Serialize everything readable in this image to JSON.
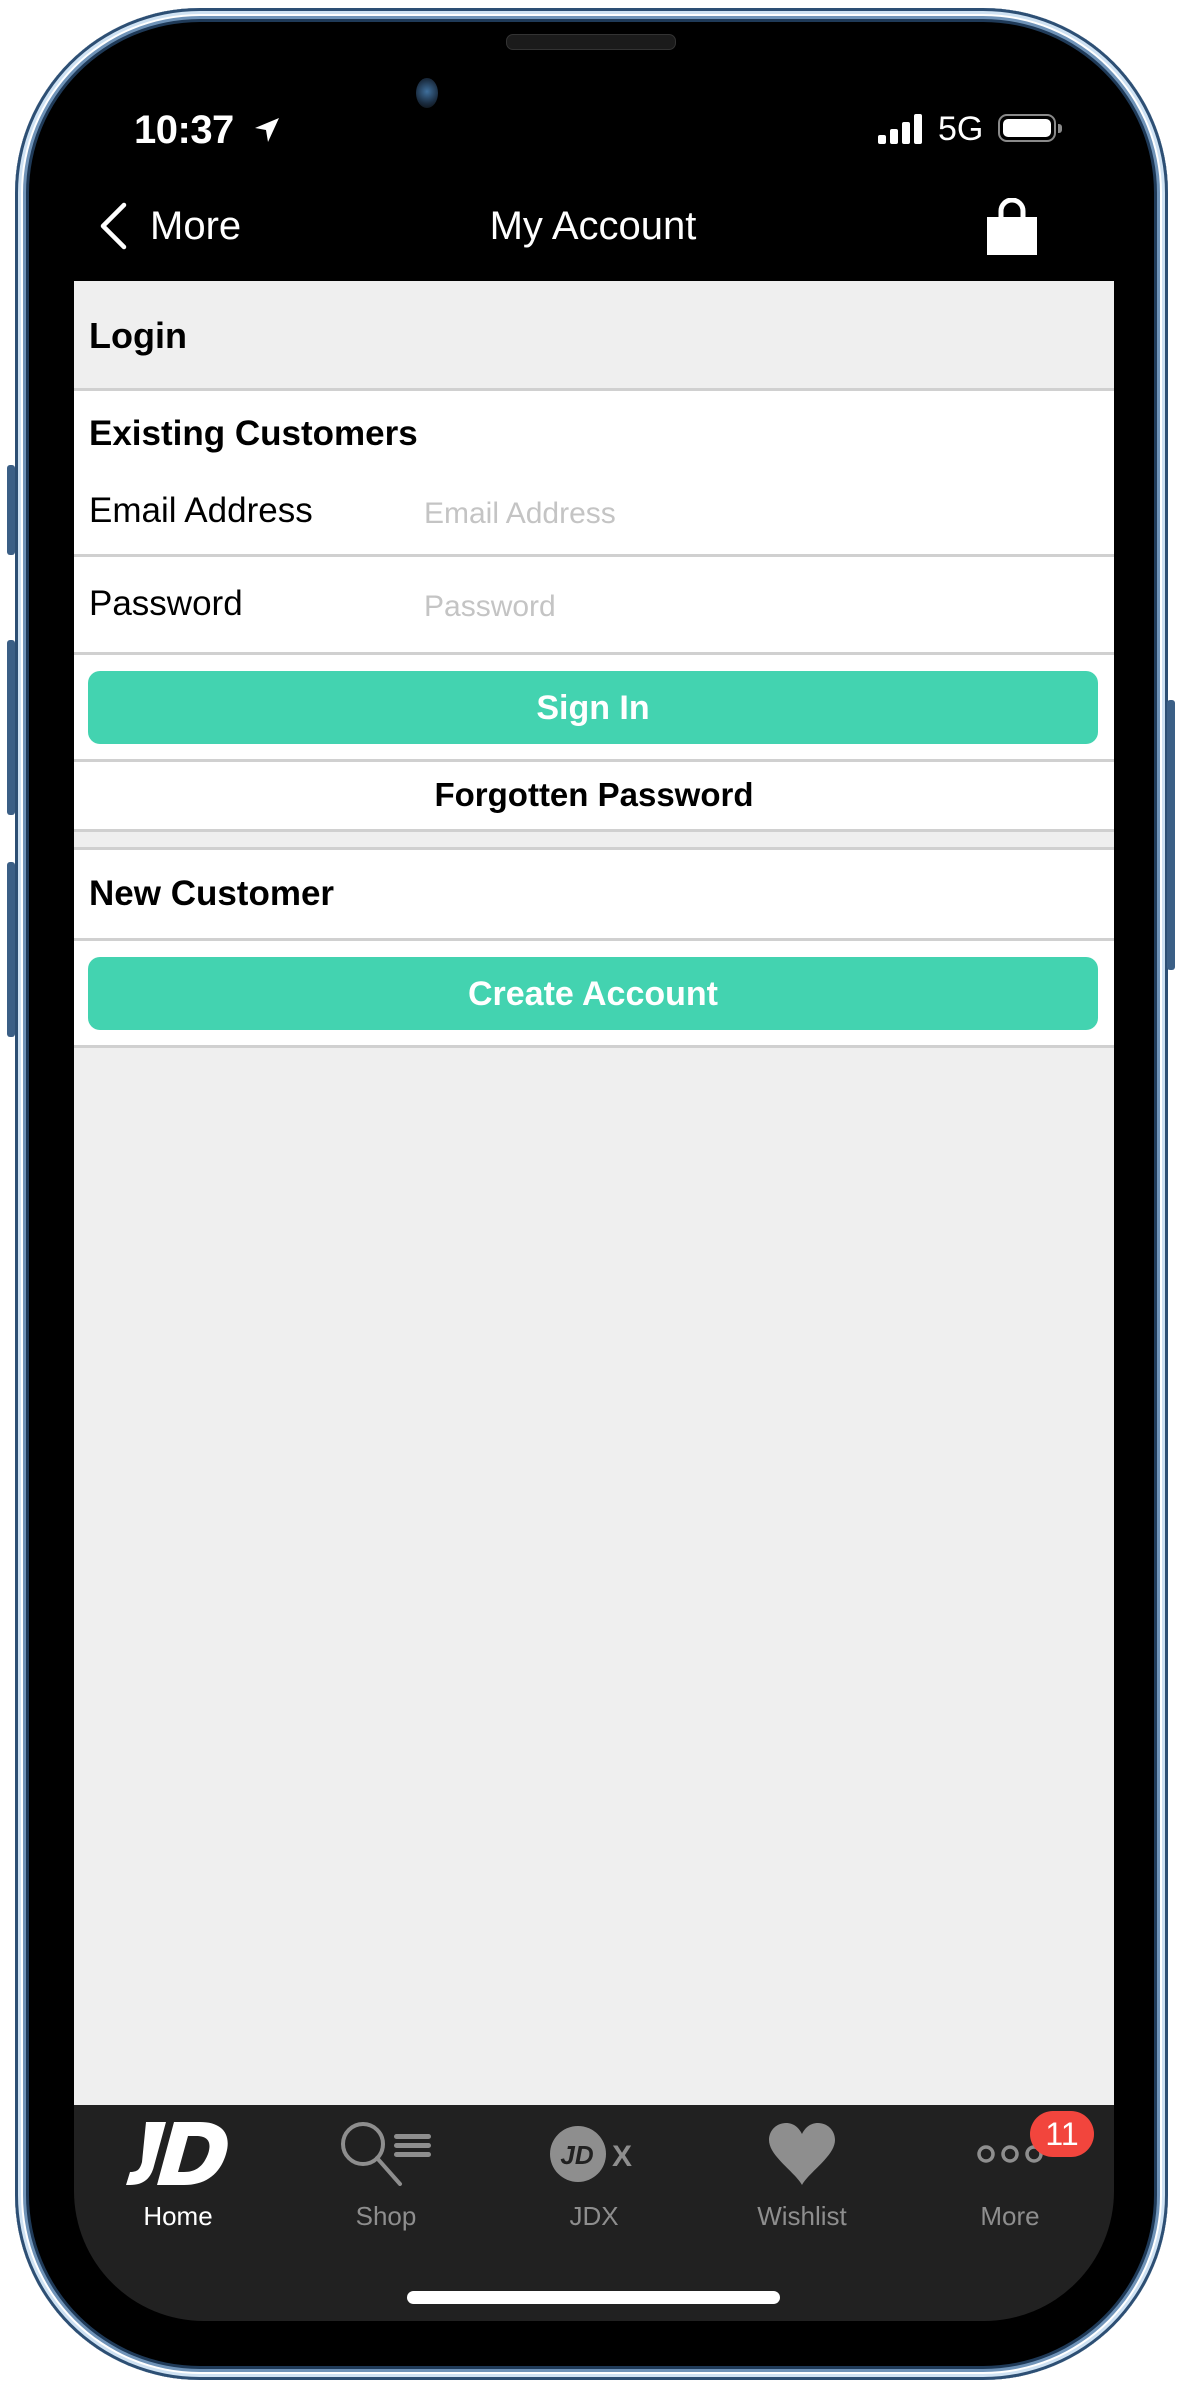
{
  "status_bar": {
    "time": "10:37",
    "location_icon": "location-arrow-icon",
    "network": "5G",
    "signal_icon": "cellular-signal-icon",
    "battery_icon": "battery-full-icon"
  },
  "nav": {
    "back_label": "More",
    "back_icon": "chevron-left-icon",
    "title": "My Account",
    "bag_icon": "shopping-bag-icon"
  },
  "login": {
    "section_title": "Login",
    "existing_title": "Existing Customers",
    "email_label": "Email Address",
    "email_value": "",
    "email_placeholder": "Email Address",
    "password_label": "Password",
    "password_value": "",
    "password_placeholder": "Password",
    "sign_in_label": "Sign In",
    "forgotten_label": "Forgotten Password",
    "new_customer_title": "New Customer",
    "create_account_label": "Create Account"
  },
  "colors": {
    "accent": "#43d3b0",
    "badge": "#f2453d",
    "tabbar_bg": "#212121",
    "page_bg": "#efefef"
  },
  "tabbar": {
    "items": [
      {
        "label": "Home",
        "icon": "jd-logo-icon",
        "active": true
      },
      {
        "label": "Shop",
        "icon": "search-list-icon",
        "active": false
      },
      {
        "label": "JDX",
        "icon": "jdx-icon",
        "active": false
      },
      {
        "label": "Wishlist",
        "icon": "heart-icon",
        "active": false
      },
      {
        "label": "More",
        "icon": "more-dots-icon",
        "active": false,
        "badge": "11"
      }
    ]
  }
}
